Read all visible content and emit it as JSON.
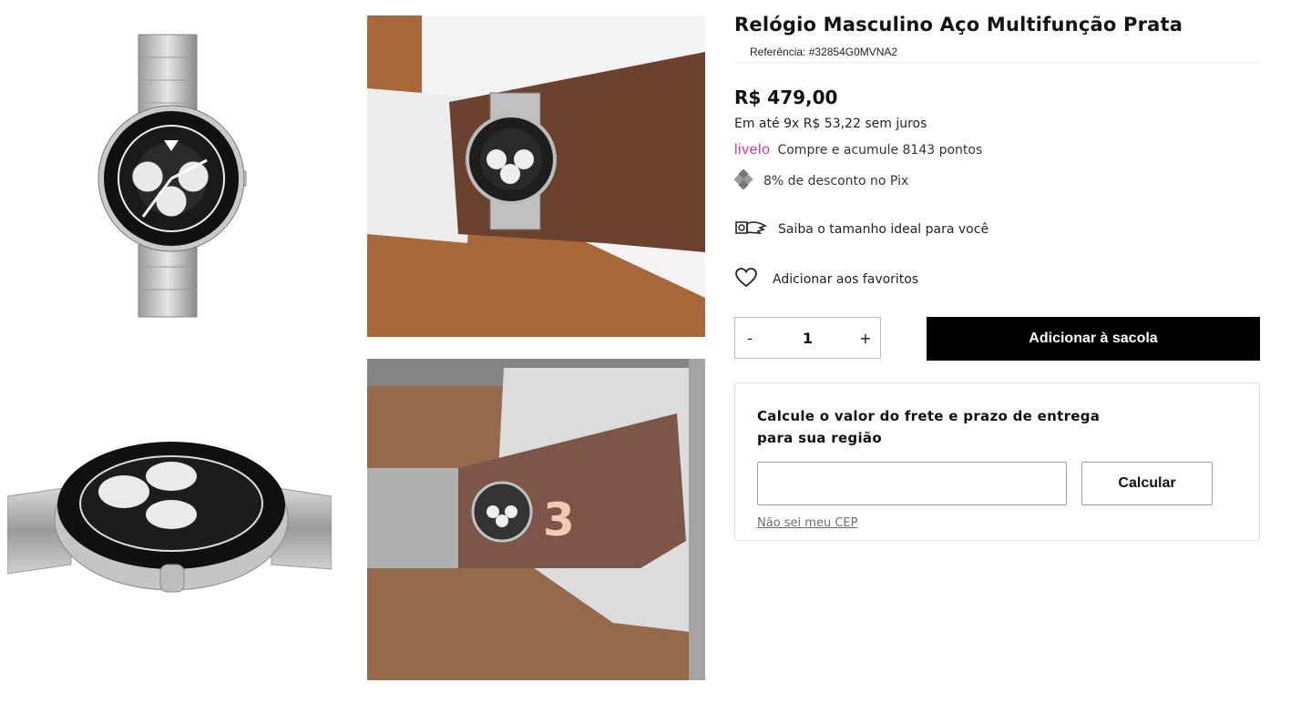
{
  "gallery": {
    "slide_number": "3"
  },
  "product": {
    "title": "Relógio Masculino Aço Multifunção Prata",
    "reference": "Referência: #32854G0MVNA2",
    "price": "R$ 479,00",
    "installments": "Em até 9x R$ 53,22 sem juros",
    "livelo_logo": "livelo",
    "livelo_text": "Compre e acumule 8143 pontos",
    "pix_text": "8% de desconto no Pix",
    "size_guide": "Saiba o tamanho ideal para você",
    "favorites": "Adicionar aos favoritos"
  },
  "cart": {
    "minus": "-",
    "quantity": "1",
    "plus": "+",
    "add_button": "Adicionar à sacola"
  },
  "shipping": {
    "title": "Calcule o valor do frete e prazo de entrega para sua região",
    "input_value": "",
    "calc_button": "Calcular",
    "unknown_cep_link": "Não sei meu CEP"
  },
  "colors": {
    "accent_black": "#000000",
    "livelo_pink": "#e0308d"
  },
  "icons": [
    "pix-icon",
    "hand-size-icon",
    "heart-icon"
  ]
}
